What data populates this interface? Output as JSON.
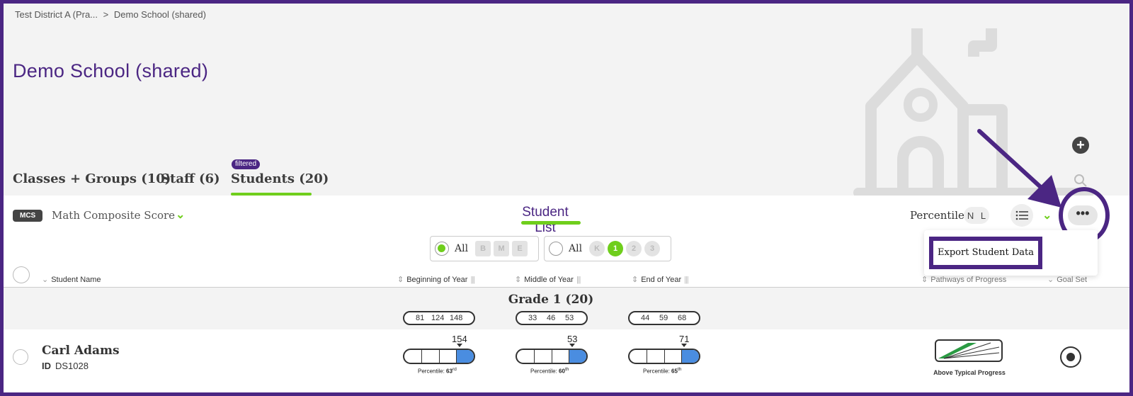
{
  "breadcrumb": {
    "district": "Test District A (Pra...",
    "separator": ">",
    "school": "Demo School (shared)"
  },
  "page_title": "Demo School (shared)",
  "tabs": [
    {
      "label": "Classes + Groups (10)"
    },
    {
      "label": "Staff (6)"
    },
    {
      "label": "Students (20)",
      "badge": "filtered",
      "active": true
    }
  ],
  "measure": {
    "badge": "MCS",
    "label": "Math Composite Score"
  },
  "list_title": "Student List",
  "percentile": {
    "label": "Percentile",
    "options": [
      "N",
      "L"
    ]
  },
  "menu": {
    "more_label": "•••",
    "export_label": "Export Student Data"
  },
  "filters": {
    "season": {
      "all_label": "All",
      "chips": [
        "B",
        "M",
        "E"
      ]
    },
    "grade": {
      "all_label": "All",
      "chips": [
        "K",
        "1",
        "2",
        "3"
      ],
      "active": "1"
    }
  },
  "columns": {
    "student_name": "Student Name",
    "boy": "Beginning of Year",
    "moy": "Middle of Year",
    "eoy": "End of Year",
    "pathways": "Pathways of Progress",
    "goal": "Goal Set"
  },
  "grade_group": {
    "label": "Grade 1 (20)",
    "ranges": {
      "boy": [
        "81",
        "124",
        "148"
      ],
      "moy": [
        "33",
        "46",
        "53"
      ],
      "eoy": [
        "44",
        "59",
        "68"
      ]
    }
  },
  "students": [
    {
      "name": "Carl Adams",
      "id_label": "ID",
      "id": "DS1028",
      "scores": {
        "boy": {
          "value": "154",
          "percentile_label": "Percentile:",
          "percentile": "63",
          "suffix": "rd"
        },
        "moy": {
          "value": "53",
          "percentile_label": "Percentile:",
          "percentile": "60",
          "suffix": "th"
        },
        "eoy": {
          "value": "71",
          "percentile_label": "Percentile:",
          "percentile": "65",
          "suffix": "th"
        }
      },
      "pathway": "Above Typical Progress"
    }
  ],
  "colors": {
    "brand": "#4b2683",
    "accent": "#6fce1c",
    "score_fill": "#4a8de0"
  }
}
